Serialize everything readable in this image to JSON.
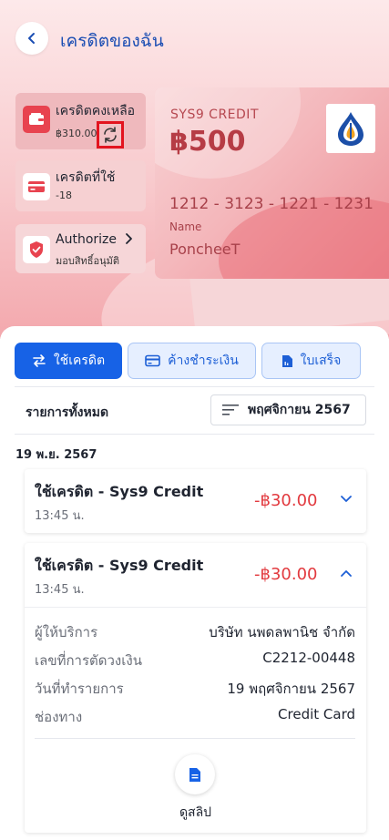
{
  "header": {
    "title": "เครดิตของฉัน"
  },
  "summary": {
    "remaining_label": "เครดิตคงเหลือ",
    "remaining_value": "฿310.00",
    "used_label": "เครดิตที่ใช้",
    "used_value": "-18",
    "authorize_label": "Authorize",
    "authorize_sub": "มอบสิทธิ์อนุมัติ"
  },
  "card": {
    "name": "SYS9 CREDIT",
    "amount": "฿500",
    "number": "1212 - 3123 - 1221 - 1231",
    "holder_label": "Name",
    "holder": "PoncheeT"
  },
  "tabs": [
    {
      "label": "ใช้เครดิต"
    },
    {
      "label": "ค้างชำระเงิน"
    },
    {
      "label": "ใบเสร็จ"
    }
  ],
  "list": {
    "all_label": "รายการทั้งหมด",
    "month": "พฤศจิกายน 2567",
    "date_header": "19 พ.ย. 2567"
  },
  "transactions": [
    {
      "title": "ใช้เครดิต - Sys9 Credit",
      "time": "13:45 น.",
      "amount": "-฿30.00"
    },
    {
      "title": "ใช้เครดิต - Sys9 Credit",
      "time": "13:45 น.",
      "amount": "-฿30.00",
      "details": [
        {
          "key": "ผู้ให้บริการ",
          "value": "บริษัท นพดลพานิช จำกัด"
        },
        {
          "key": "เลขที่การตัดวงเงิน",
          "value": "C2212-00448"
        },
        {
          "key": "วันที่ทำรายการ",
          "value": "19 พฤศจิกายน 2567"
        },
        {
          "key": "ช่องทาง",
          "value": "Credit Card"
        }
      ],
      "slip_label": "ดูสลิป"
    }
  ],
  "colors": {
    "primary": "#1762e6",
    "accent_red": "#e8434f",
    "negative": "#e23a3f"
  }
}
